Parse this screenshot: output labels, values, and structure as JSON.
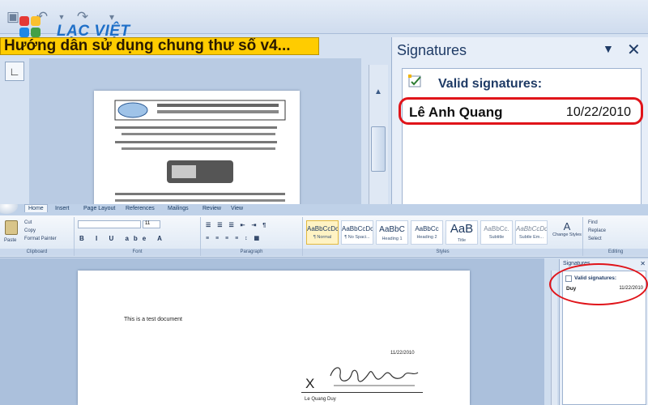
{
  "brand": {
    "name": "LẠC VIỆT"
  },
  "top_window": {
    "document_title": "Hướng dẫn sử dụng chung thư số v4...",
    "signatures_pane": {
      "title": "Signatures",
      "valid_heading": "Valid signatures:",
      "entries": [
        {
          "signer": "Lê Anh Quang",
          "date": "10/22/2010"
        }
      ]
    }
  },
  "bottom_window": {
    "tabs": [
      "Home",
      "Insert",
      "Page Layout",
      "References",
      "Mailings",
      "Review",
      "View"
    ],
    "active_tab": "Home",
    "clipboard": {
      "paste": "Paste",
      "cut": "Cut",
      "copy": "Copy",
      "format_painter": "Format Painter",
      "label": "Clipboard"
    },
    "font": {
      "size": "11",
      "label": "Font"
    },
    "paragraph": {
      "label": "Paragraph"
    },
    "styles": {
      "label": "Styles",
      "items": [
        {
          "sample": "AaBbCcDc",
          "name": "¶ Normal"
        },
        {
          "sample": "AaBbCcDc",
          "name": "¶ No Spaci..."
        },
        {
          "sample": "AaBbC",
          "name": "Heading 1"
        },
        {
          "sample": "AaBbCc",
          "name": "Heading 2"
        },
        {
          "sample": "AaB",
          "name": "Title"
        },
        {
          "sample": "AaBbCc.",
          "name": "Subtitle"
        },
        {
          "sample": "AaBbCcDc",
          "name": "Subtle Em..."
        }
      ],
      "change_styles": "Change Styles"
    },
    "editing": {
      "find": "Find",
      "replace": "Replace",
      "select": "Select",
      "label": "Editing"
    },
    "document": {
      "body_text": "This is a test document",
      "date": "11/22/2010",
      "signature_mark": "X",
      "signer_line": "Le Quang Duy"
    },
    "signatures_pane": {
      "title": "Signatures",
      "valid_heading": "Valid signatures:",
      "entries": [
        {
          "signer": "Duy",
          "date": "11/22/2010"
        }
      ]
    }
  },
  "colors": {
    "highlight_red": "#e0141a",
    "title_yellow": "#ffcc00",
    "brand_blue": "#1e6fc8"
  }
}
